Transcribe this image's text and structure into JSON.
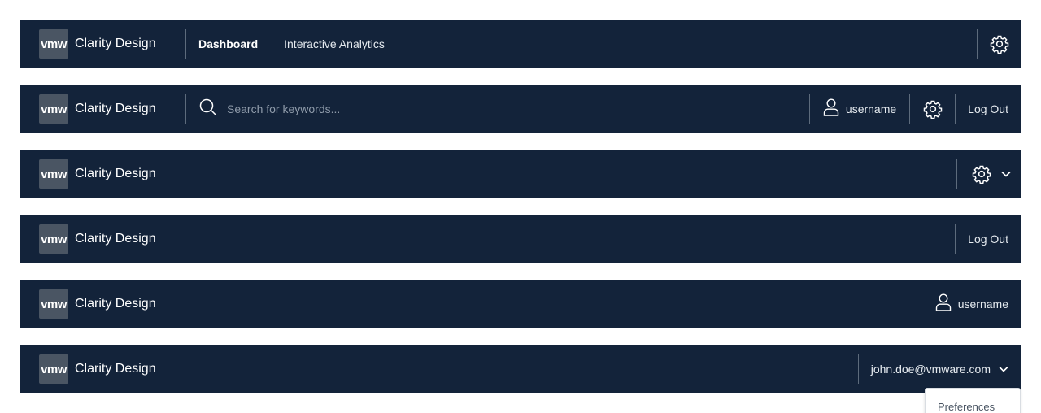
{
  "headers": [
    {
      "brand": {
        "logo": "vmw",
        "title": "Clarity Design"
      },
      "nav": [
        {
          "label": "Dashboard",
          "active": true
        },
        {
          "label": "Interactive Analytics",
          "active": false
        }
      ],
      "actions": [
        {
          "icon": "gear-icon"
        }
      ]
    },
    {
      "brand": {
        "logo": "vmw",
        "title": "Clarity Design"
      },
      "search": {
        "icon": "search-icon",
        "placeholder": "Search for keywords..."
      },
      "user": {
        "icon": "user-icon",
        "label": "username"
      },
      "settings": {
        "icon": "gear-icon"
      },
      "logout": "Log Out"
    },
    {
      "brand": {
        "logo": "vmw",
        "title": "Clarity Design"
      },
      "settings": {
        "icon": "gear-icon",
        "caret": "chevron-down-icon"
      }
    },
    {
      "brand": {
        "logo": "vmw",
        "title": "Clarity Design"
      },
      "logout": "Log Out"
    },
    {
      "brand": {
        "logo": "vmw",
        "title": "Clarity Design"
      },
      "user": {
        "icon": "user-icon",
        "label": "username"
      }
    },
    {
      "brand": {
        "logo": "vmw",
        "title": "Clarity Design"
      },
      "account": {
        "label": "john.doe@vmware.com",
        "caret": "chevron-down-icon"
      },
      "menu": [
        {
          "label": "Preferences"
        }
      ]
    }
  ],
  "colors": {
    "header_bg": "#13233a",
    "logo_bg": "#4a5563",
    "separator": "#5d6b7c",
    "placeholder": "#8f9baa"
  }
}
